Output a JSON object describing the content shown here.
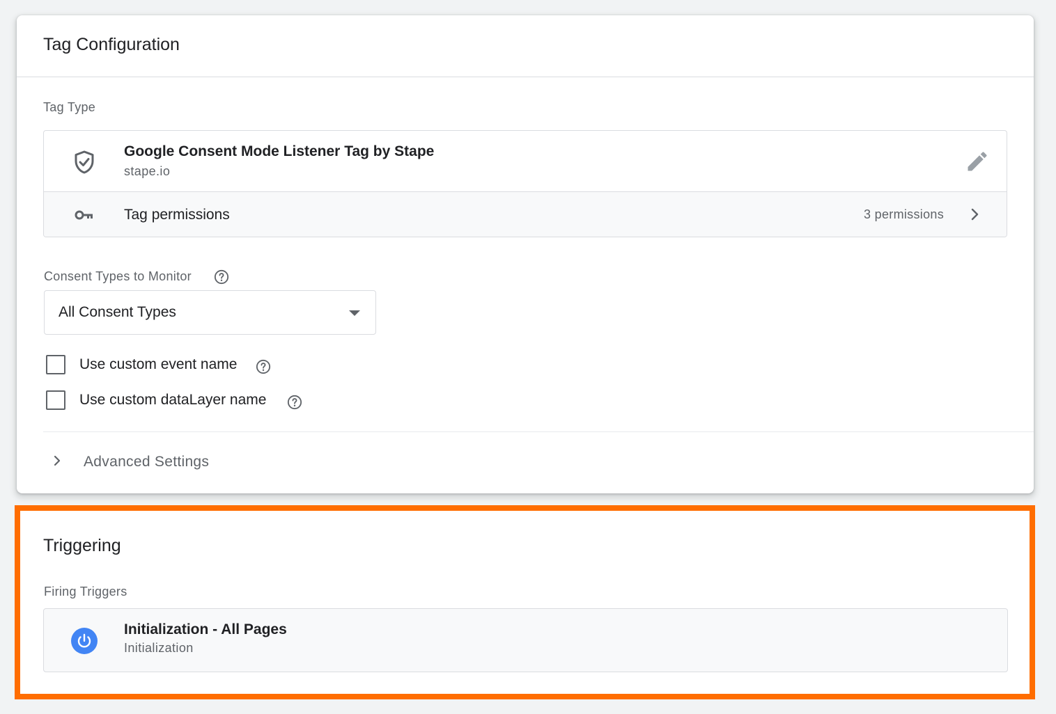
{
  "tag_configuration": {
    "title": "Tag Configuration",
    "tag_type_label": "Tag Type",
    "tag_type": {
      "name": "Google Consent Mode Listener Tag by Stape",
      "vendor": "stape.io",
      "icon": "shield-check-icon"
    },
    "permissions": {
      "label": "Tag permissions",
      "count": "3 permissions"
    },
    "consent_types": {
      "label": "Consent Types to Monitor",
      "selected": "All Consent Types"
    },
    "checkboxes": [
      {
        "label": "Use custom event name",
        "checked": false
      },
      {
        "label": "Use custom dataLayer name",
        "checked": false
      }
    ],
    "advanced_settings_label": "Advanced Settings"
  },
  "triggering": {
    "title": "Triggering",
    "firing_triggers_label": "Firing Triggers",
    "triggers": [
      {
        "name": "Initialization - All Pages",
        "type": "Initialization",
        "icon": "power-icon"
      }
    ]
  },
  "colors": {
    "highlight": "#ff6d00",
    "trigger_icon": "#4285f4",
    "muted_text": "#5f6368"
  }
}
